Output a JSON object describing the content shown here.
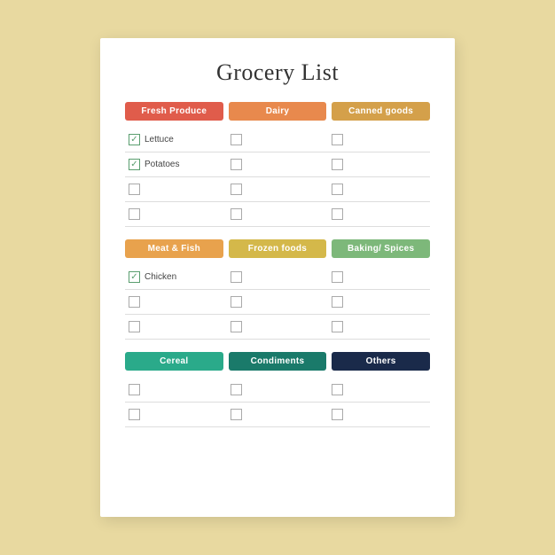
{
  "title": "Grocery List",
  "sections": [
    {
      "id": "section1",
      "categories": [
        {
          "label": "Fresh Produce",
          "color": "#e05c4b"
        },
        {
          "label": "Dairy",
          "color": "#e8894d"
        },
        {
          "label": "Canned goods",
          "color": "#d4a04a"
        }
      ],
      "rows": [
        [
          {
            "checked": true,
            "label": "Lettuce"
          },
          {
            "checked": false,
            "label": ""
          },
          {
            "checked": false,
            "label": ""
          }
        ],
        [
          {
            "checked": true,
            "label": "Potatoes"
          },
          {
            "checked": false,
            "label": ""
          },
          {
            "checked": false,
            "label": ""
          }
        ],
        [
          {
            "checked": false,
            "label": ""
          },
          {
            "checked": false,
            "label": ""
          },
          {
            "checked": false,
            "label": ""
          }
        ],
        [
          {
            "checked": false,
            "label": ""
          },
          {
            "checked": false,
            "label": ""
          },
          {
            "checked": false,
            "label": ""
          }
        ]
      ]
    },
    {
      "id": "section2",
      "categories": [
        {
          "label": "Meat & Fish",
          "color": "#e8a24d"
        },
        {
          "label": "Frozen foods",
          "color": "#d4b84a"
        },
        {
          "label": "Baking/ Spices",
          "color": "#7db87a"
        }
      ],
      "rows": [
        [
          {
            "checked": true,
            "label": "Chicken"
          },
          {
            "checked": false,
            "label": ""
          },
          {
            "checked": false,
            "label": ""
          }
        ],
        [
          {
            "checked": false,
            "label": ""
          },
          {
            "checked": false,
            "label": ""
          },
          {
            "checked": false,
            "label": ""
          }
        ],
        [
          {
            "checked": false,
            "label": ""
          },
          {
            "checked": false,
            "label": ""
          },
          {
            "checked": false,
            "label": ""
          }
        ]
      ]
    },
    {
      "id": "section3",
      "categories": [
        {
          "label": "Cereal",
          "color": "#2aaa8a"
        },
        {
          "label": "Condiments",
          "color": "#1a7a6a"
        },
        {
          "label": "Others",
          "color": "#1a2a4a"
        }
      ],
      "rows": [
        [
          {
            "checked": false,
            "label": ""
          },
          {
            "checked": false,
            "label": ""
          },
          {
            "checked": false,
            "label": ""
          }
        ],
        [
          {
            "checked": false,
            "label": ""
          },
          {
            "checked": false,
            "label": ""
          },
          {
            "checked": false,
            "label": ""
          }
        ]
      ]
    }
  ]
}
